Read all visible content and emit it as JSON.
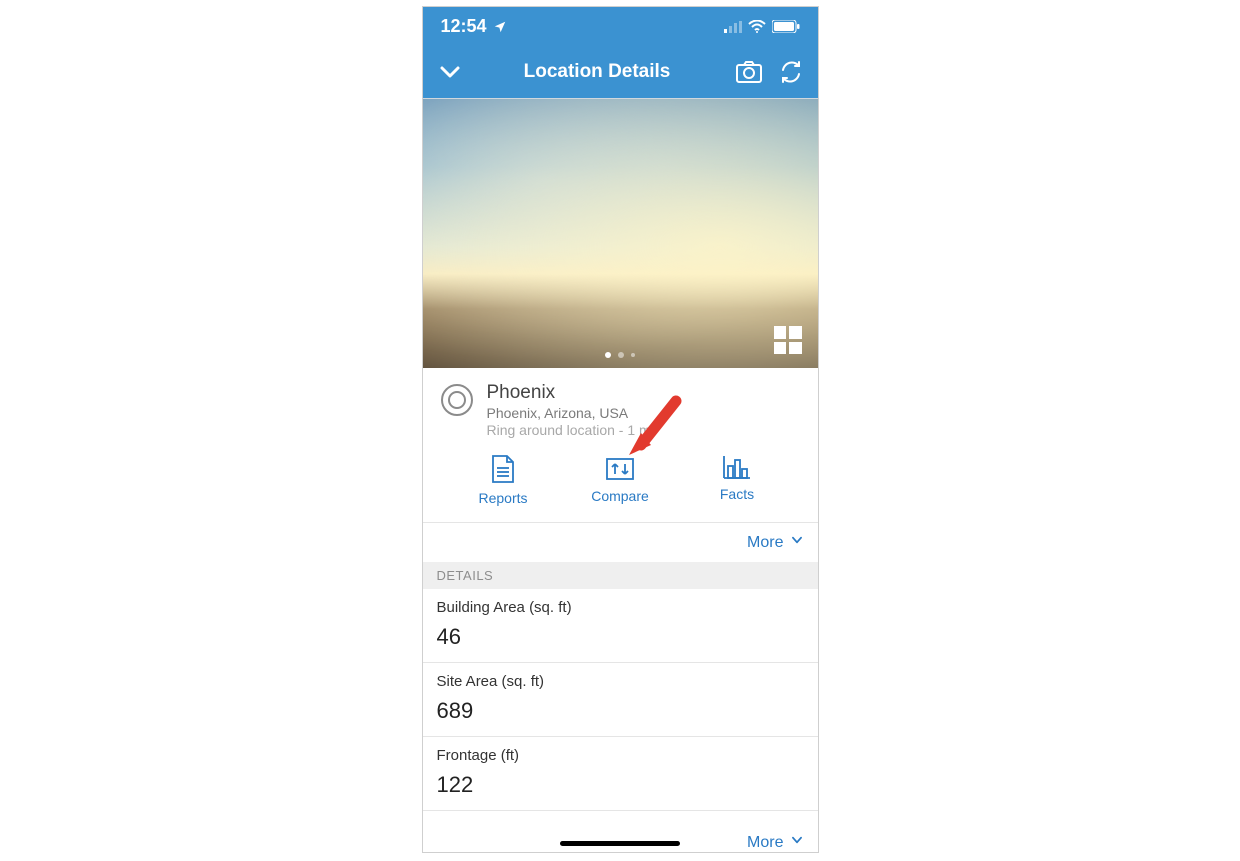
{
  "statusbar": {
    "time": "12:54",
    "location_icon": "location-arrow",
    "signal_label": "cellular-signal",
    "wifi_label": "wifi",
    "battery_label": "battery-full"
  },
  "navbar": {
    "back_icon": "chevron-down",
    "title": "Location Details",
    "camera_icon": "camera",
    "refresh_icon": "refresh"
  },
  "hero": {
    "gallery_icon": "grid",
    "page_dots": 3,
    "active_dot": 0,
    "image_description": "wide sky at sunset over open field"
  },
  "location": {
    "title": "Phoenix",
    "address": "Phoenix, Arizona, USA",
    "ring_text": "Ring around location - 1 mi"
  },
  "actions": {
    "reports": {
      "label": "Reports",
      "icon": "document"
    },
    "compare": {
      "label": "Compare",
      "icon": "compare"
    },
    "facts": {
      "label": "Facts",
      "icon": "bar-chart"
    }
  },
  "more_label": "More",
  "details_header": "DETAILS",
  "details": [
    {
      "label": "Building Area (sq. ft)",
      "value": "46"
    },
    {
      "label": "Site Area (sq. ft)",
      "value": "689"
    },
    {
      "label": "Frontage (ft)",
      "value": "122"
    }
  ],
  "annotation": {
    "arrow_color": "#e23a2e",
    "target": "compare"
  },
  "colors": {
    "header_blue": "#3b92d1",
    "link_blue": "#2a7ac4",
    "muted_gray": "#8d8d8d"
  }
}
